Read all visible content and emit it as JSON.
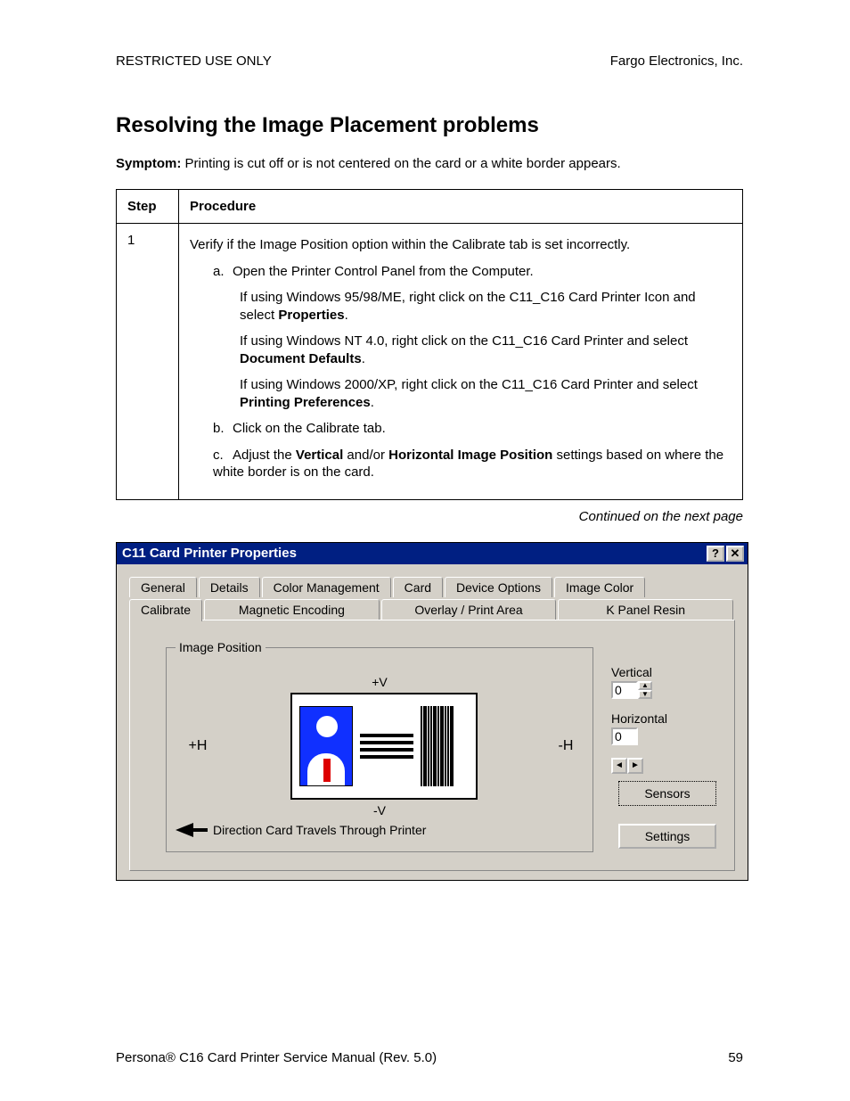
{
  "header": {
    "left": "RESTRICTED USE ONLY",
    "right": "Fargo Electronics, Inc."
  },
  "title": "Resolving the Image Placement problems",
  "symptom": {
    "label": "Symptom:",
    "text": "  Printing is cut off or is not centered on the card or a white border appears."
  },
  "table": {
    "col1": "Step",
    "col2": "Procedure",
    "step": "1",
    "p0": "Verify if the Image Position option within the Calibrate tab is set incorrectly.",
    "a": "a.",
    "a_txt": "Open the Printer Control Panel from the Computer.",
    "a1a": "If using Windows 95/98/ME, right click on the C11_C16 Card Printer Icon and select ",
    "a1b": "Properties",
    "a1c": ".",
    "a2a": "If using Windows NT 4.0, right click on the C11_C16 Card Printer and select ",
    "a2b": "Document Defaults",
    "a2c": ".",
    "a3a": "If using Windows 2000/XP, right click on the C11_C16 Card Printer and select ",
    "a3b": "Printing Preferences",
    "a3c": ".",
    "b": "b.",
    "b_txt": "Click on the Calibrate tab.",
    "c": "c.",
    "c1": "Adjust the ",
    "c2": "Vertical",
    "c3": " and/or ",
    "c4": "Horizontal Image Position",
    "c5": " settings based on where the white border is on the card."
  },
  "continued": "Continued on the next page",
  "dialog": {
    "title": "C11 Card Printer Properties",
    "help": "?",
    "close": "✕",
    "tabs_row1": [
      "General",
      "Details",
      "Color Management",
      "Card",
      "Device Options",
      "Image Color"
    ],
    "tabs_row2": [
      "Calibrate",
      "Magnetic Encoding",
      "Overlay / Print Area",
      "K Panel Resin"
    ],
    "active_tab": "Calibrate",
    "group_label": "Image Position",
    "plusV": "+V",
    "minusV": "-V",
    "plusH": "+H",
    "minusH": "-H",
    "direction": "Direction Card Travels Through Printer",
    "vert_label": "Vertical",
    "vert_value": "0",
    "horiz_label": "Horizontal",
    "horiz_value": "0",
    "btn_sensors": "Sensors",
    "btn_settings": "Settings"
  },
  "footer": {
    "left": "Persona® C16 Card Printer Service Manual (Rev. 5.0)",
    "right": "59"
  }
}
